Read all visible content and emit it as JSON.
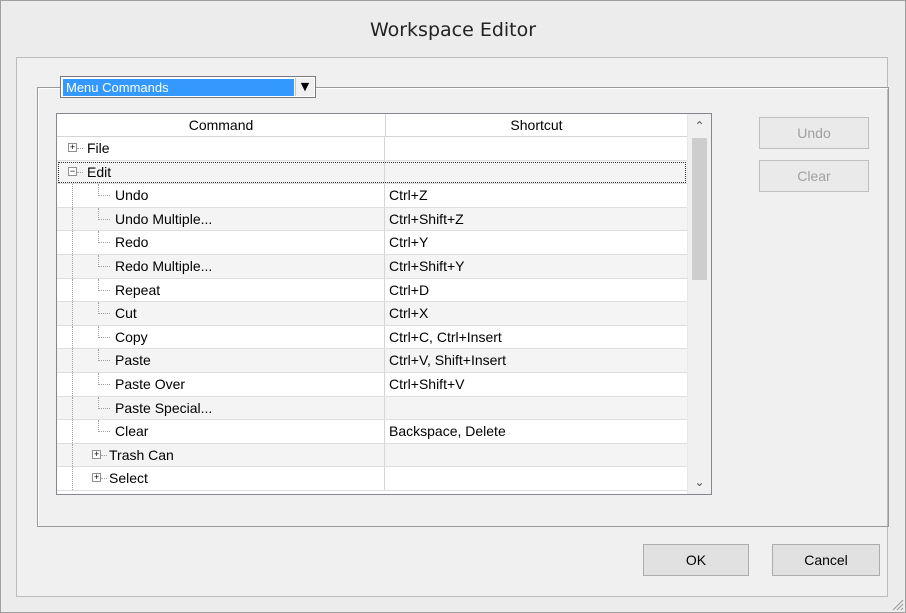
{
  "window": {
    "title": "Workspace Editor"
  },
  "selector": {
    "value": "Menu Commands",
    "dropdown_glyph": "▼"
  },
  "list": {
    "columns": [
      "Command",
      "Shortcut"
    ],
    "rows": [
      {
        "label": "File",
        "shortcut": "",
        "level": 0,
        "expander": "+"
      },
      {
        "label": "Edit",
        "shortcut": "",
        "level": 0,
        "expander": "−",
        "selected": true
      },
      {
        "label": "Undo",
        "shortcut": "Ctrl+Z",
        "level": 1
      },
      {
        "label": "Undo Multiple...",
        "shortcut": "Ctrl+Shift+Z",
        "level": 1
      },
      {
        "label": "Redo",
        "shortcut": "Ctrl+Y",
        "level": 1
      },
      {
        "label": "Redo Multiple...",
        "shortcut": "Ctrl+Shift+Y",
        "level": 1
      },
      {
        "label": "Repeat",
        "shortcut": "Ctrl+D",
        "level": 1
      },
      {
        "label": "Cut",
        "shortcut": "Ctrl+X",
        "level": 1
      },
      {
        "label": "Copy",
        "shortcut": "Ctrl+C, Ctrl+Insert",
        "level": 1
      },
      {
        "label": "Paste",
        "shortcut": "Ctrl+V, Shift+Insert",
        "level": 1
      },
      {
        "label": "Paste Over",
        "shortcut": "Ctrl+Shift+V",
        "level": 1
      },
      {
        "label": "Paste Special...",
        "shortcut": "",
        "level": 1
      },
      {
        "label": "Clear",
        "shortcut": "Backspace, Delete",
        "level": 1
      },
      {
        "label": "Trash Can",
        "shortcut": "",
        "level": 1,
        "expander": "+"
      },
      {
        "label": "Select",
        "shortcut": "",
        "level": 1,
        "expander": "+"
      }
    ],
    "scroll_up_glyph": "⌃",
    "scroll_down_glyph": "⌄"
  },
  "side_buttons": {
    "undo": "Undo",
    "clear": "Clear"
  },
  "footer": {
    "ok": "OK",
    "cancel": "Cancel"
  },
  "colors": {
    "selection": "#3399ff",
    "window_bg": "#f0f0f0"
  }
}
